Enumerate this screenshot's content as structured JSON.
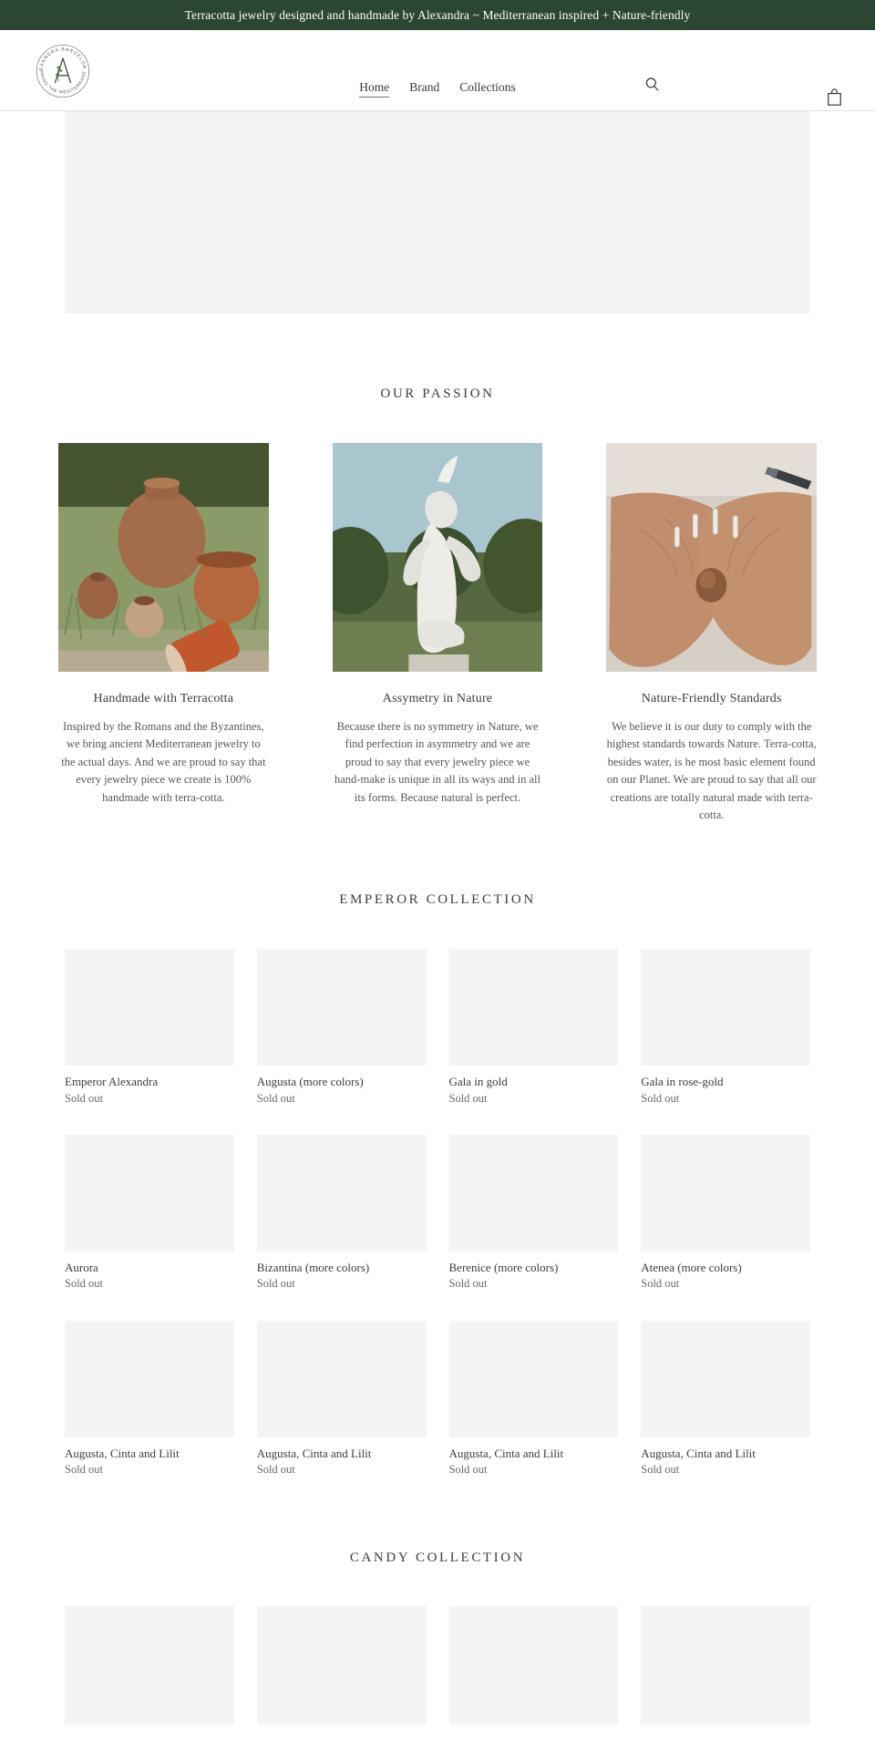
{
  "announcement": {
    "text": "Terracotta jewelry designed and handmade by Alexandra ~ Mediterranean inspired + Nature-friendly",
    "background": "#2b4632",
    "color": "#ffffff"
  },
  "header": {
    "logo": {
      "alt": "Alexandra Barcelona seal logo",
      "outer_text_top": "ALEXANDRA BARCELONA ·",
      "outer_text_bottom": "SHARING THE MEDITERRANEAN",
      "monogram": "A"
    },
    "nav": [
      {
        "label": "Home",
        "active": true
      },
      {
        "label": "Brand",
        "active": false
      },
      {
        "label": "Collections",
        "active": false
      }
    ],
    "search_icon": "search-icon",
    "cart_icon": "shopping-bag-icon"
  },
  "hero": {
    "placeholder": true
  },
  "passion": {
    "title": "OUR PASSION",
    "columns": [
      {
        "image": "terracotta-pots-in-grass",
        "heading": "Handmade with Terracotta",
        "text": "Inspired by the Romans and the Byzantines, we bring ancient Mediterranean jewelry to the actual days. And we are proud to say that every jewelry piece we create is 100% handmade with terra-cotta."
      },
      {
        "image": "classical-marble-statue",
        "heading": "Assymetry in Nature",
        "text": "Because there is no symmetry in Nature, we find perfection in asymmetry and we are proud to say that every jewelry piece we hand-make is unique in all its ways and in all its forms. Because natural is perfect."
      },
      {
        "image": "hands-holding-jewelry",
        "heading": "Nature-Friendly Standards",
        "text": "We believe it is our duty to comply with the highest standards towards Nature. Terra-cotta, besides water, is he most basic element found on our Planet. We are proud to say that all our creations are totally natural made with terra-cotta."
      }
    ]
  },
  "emperor_collection": {
    "title": "EMPEROR COLLECTION",
    "products": [
      {
        "title": "Emperor Alexandra",
        "price": "Sold out"
      },
      {
        "title": "Augusta (more colors)",
        "price": "Sold out"
      },
      {
        "title": "Gala in gold",
        "price": "Sold out"
      },
      {
        "title": "Gala in rose-gold",
        "price": "Sold out"
      },
      {
        "title": "Aurora",
        "price": "Sold out"
      },
      {
        "title": "Bizantina (more colors)",
        "price": "Sold out"
      },
      {
        "title": "Berenice (more colors)",
        "price": "Sold out"
      },
      {
        "title": "Atenea (more colors)",
        "price": "Sold out"
      },
      {
        "title": "Augusta, Cinta and Lilit",
        "price": "Sold out"
      },
      {
        "title": "Augusta, Cinta and Lilit",
        "price": "Sold out"
      },
      {
        "title": "Augusta, Cinta and Lilit",
        "price": "Sold out"
      },
      {
        "title": "Augusta, Cinta and Lilit",
        "price": "Sold out"
      }
    ]
  },
  "candy_collection": {
    "title": "CANDY COLLECTION",
    "products": [
      {
        "title": "",
        "price": ""
      },
      {
        "title": "",
        "price": ""
      },
      {
        "title": "",
        "price": ""
      },
      {
        "title": "",
        "price": ""
      }
    ]
  }
}
